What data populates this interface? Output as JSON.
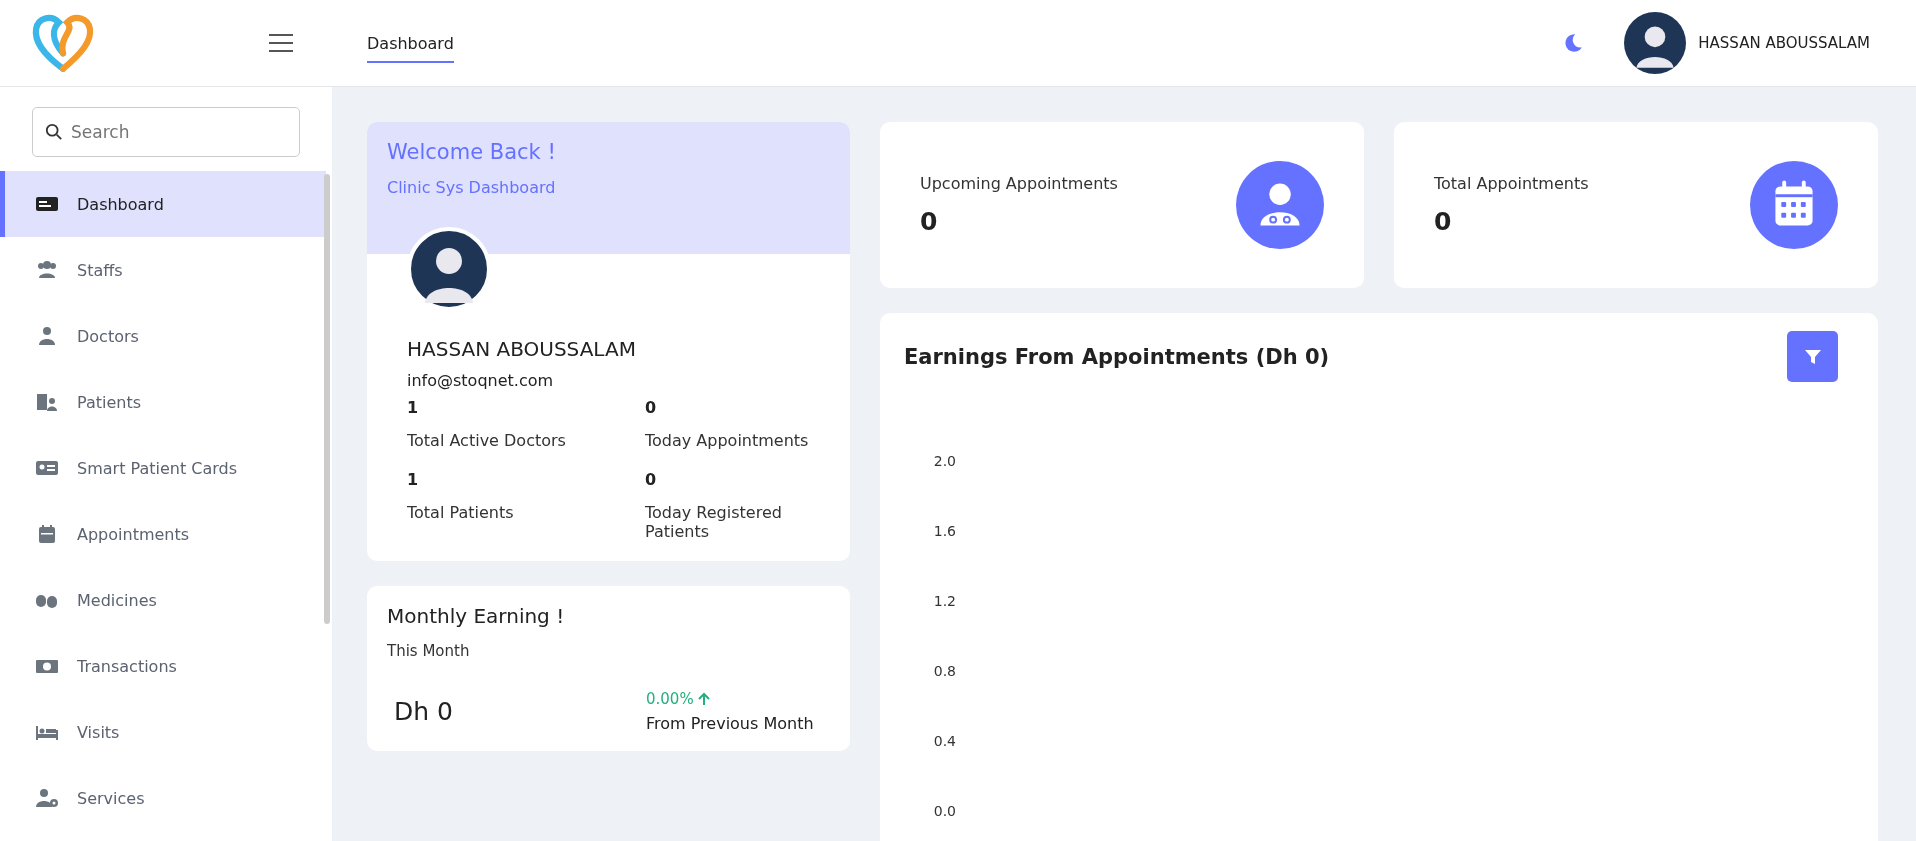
{
  "header": {
    "tab": {
      "label": "Dashboard",
      "selected": true
    },
    "user_name": "HASSAN ABOUSSALAM"
  },
  "sidebar": {
    "search": {
      "placeholder": "Search"
    },
    "items": [
      {
        "label": "Dashboard",
        "selected": true
      },
      {
        "label": "Staffs",
        "selected": false
      },
      {
        "label": "Doctors",
        "selected": false
      },
      {
        "label": "Patients",
        "selected": false
      },
      {
        "label": "Smart Patient Cards",
        "selected": false
      },
      {
        "label": "Appointments",
        "selected": false
      },
      {
        "label": "Medicines",
        "selected": false
      },
      {
        "label": "Transactions",
        "selected": false
      },
      {
        "label": "Visits",
        "selected": false
      },
      {
        "label": "Services",
        "selected": false
      }
    ]
  },
  "welcome_card": {
    "title": "Welcome Back !",
    "subtitle": "Clinic Sys Dashboard",
    "name": "HASSAN ABOUSSALAM",
    "email": "info@stoqnet.com",
    "stats": [
      {
        "value": "1",
        "label": "Total Active Doctors"
      },
      {
        "value": "0",
        "label": "Today Appointments"
      },
      {
        "value": "1",
        "label": "Total Patients"
      },
      {
        "value": "0",
        "label": "Today Registered Patients"
      }
    ]
  },
  "monthly_card": {
    "title": "Monthly Earning !",
    "subtitle": "This Month",
    "amount": "Dh 0",
    "change": "0.00%",
    "change_label": "From Previous Month"
  },
  "stat_cards": [
    {
      "label": "Upcoming Appointments",
      "value": "0"
    },
    {
      "label": "Total Appointments",
      "value": "0"
    }
  ],
  "earnings_chart": {
    "title": "Earnings From Appointments (Dh 0)",
    "y_axis_labels": [
      "2.0",
      "1.6",
      "1.2",
      "0.8",
      "0.4",
      "0.0"
    ]
  }
}
